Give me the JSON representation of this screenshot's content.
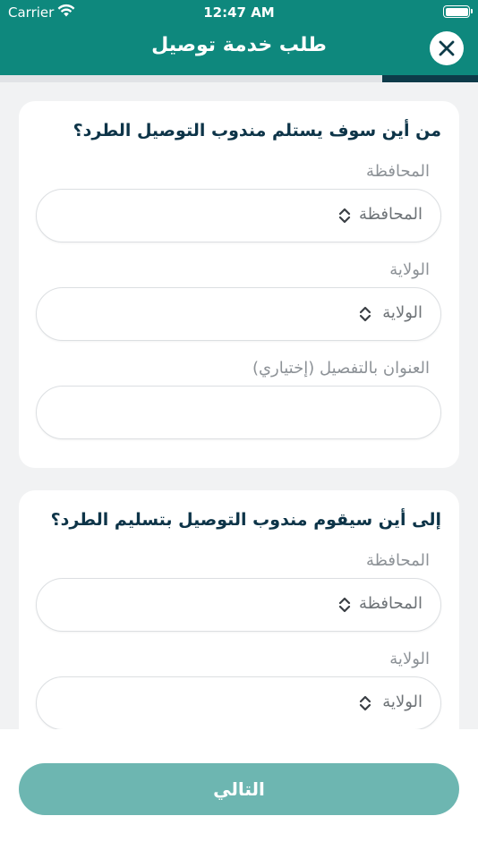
{
  "status_bar": {
    "carrier": "Carrier",
    "time": "12:47 AM"
  },
  "header": {
    "title": "طلب خدمة توصيل",
    "close_icon": "close-icon"
  },
  "progress": {
    "fraction": 0.2
  },
  "pickup": {
    "title": "من أين سوف يستلم مندوب التوصيل الطرد؟",
    "governorate_label": "المحافظة",
    "governorate_value": "المحافظة",
    "state_label": "الولاية",
    "state_value": "الولاية",
    "address_label": "العنوان بالتفصيل (إختياري)",
    "address_value": ""
  },
  "delivery": {
    "title": "إلى أين سيقوم مندوب التوصيل بتسليم الطرد؟",
    "governorate_label": "المحافظة",
    "governorate_value": "المحافظة",
    "state_label": "الولاية",
    "state_value": "الولاية"
  },
  "footer": {
    "next_label": "التالي"
  },
  "colors": {
    "primary": "#0e887d",
    "button_disabled": "#6db6b1",
    "title": "#0d3448"
  }
}
